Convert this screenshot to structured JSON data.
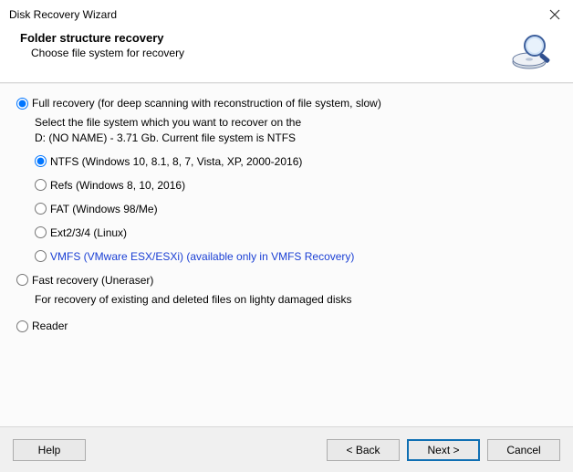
{
  "titlebar": {
    "title": "Disk Recovery Wizard"
  },
  "header": {
    "heading": "Folder structure recovery",
    "subheading": "Choose file system for recovery"
  },
  "modes": {
    "full": {
      "label": "Full recovery (for deep scanning with reconstruction of file system, slow)",
      "desc_line1": "Select the file system which you want to recover on the",
      "desc_line2": "D: (NO NAME) - 3.71 Gb. Current file system is NTFS",
      "fs": {
        "ntfs": "NTFS (Windows 10, 8.1, 8, 7, Vista, XP, 2000-2016)",
        "refs": "Refs (Windows 8, 10, 2016)",
        "fat": "FAT (Windows 98/Me)",
        "ext": "Ext2/3/4 (Linux)",
        "vmfs": "VMFS (VMware ESX/ESXi) (available only in VMFS Recovery)"
      }
    },
    "fast": {
      "label": "Fast recovery (Uneraser)",
      "desc": "For recovery of existing and deleted files on lighty damaged disks"
    },
    "reader": {
      "label": "Reader"
    }
  },
  "buttons": {
    "help": "Help",
    "back": "< Back",
    "next": "Next >",
    "cancel": "Cancel"
  }
}
